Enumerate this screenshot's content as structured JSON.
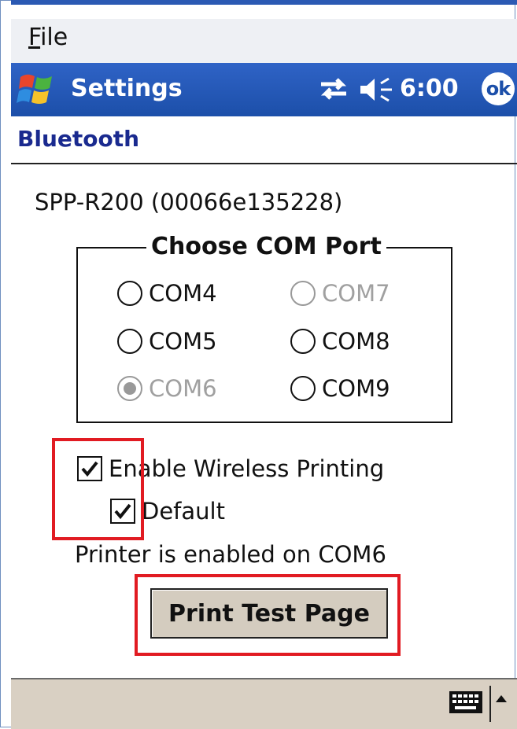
{
  "menu": {
    "file_label": "File"
  },
  "titlebar": {
    "title": "Settings",
    "time": "6:00",
    "ok_label": "ok"
  },
  "tab": {
    "title": "Bluetooth"
  },
  "device": {
    "name": "SPP-R200 (00066e135228)"
  },
  "com_group": {
    "title": "Choose COM Port",
    "ports": [
      {
        "label": "COM4",
        "enabled": true,
        "selected": false
      },
      {
        "label": "COM7",
        "enabled": false,
        "selected": false
      },
      {
        "label": "COM5",
        "enabled": true,
        "selected": false
      },
      {
        "label": "COM8",
        "enabled": true,
        "selected": false
      },
      {
        "label": "COM6",
        "enabled": false,
        "selected": true
      },
      {
        "label": "COM9",
        "enabled": true,
        "selected": false
      }
    ]
  },
  "options": {
    "enable_wireless_label": "Enable Wireless Printing",
    "enable_wireless_checked": true,
    "default_label": "Default",
    "default_checked": true
  },
  "status": {
    "text": "Printer is enabled on COM6"
  },
  "actions": {
    "print_test_label": "Print Test Page"
  },
  "colors": {
    "titlebar_blue": "#1c4fa9",
    "highlight_red": "#e11b22",
    "bottom_bar": "#d9d0c3"
  }
}
